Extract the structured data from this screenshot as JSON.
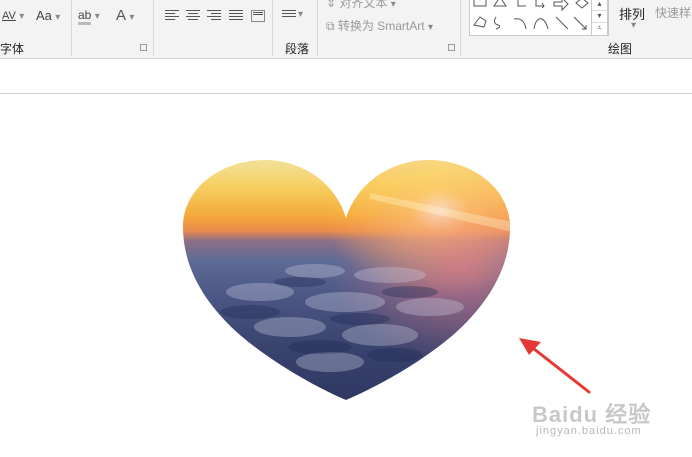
{
  "ribbon": {
    "font_group": {
      "label": "字体",
      "char_spacing": "AV",
      "change_case": "Aa",
      "highlight": "ab",
      "font_color": "A"
    },
    "paragraph_group": {
      "label": "段落",
      "align_text": "对齐文本",
      "convert_smartart": "转换为 SmartArt"
    },
    "drawing_group": {
      "label": "绘图",
      "arrange": "排列",
      "quick_styles": "快速样"
    }
  },
  "slide": {
    "heart_picture": "heart-shaped sunset over clouds image",
    "arrow_color": "#e53935"
  },
  "watermark": {
    "brand": "Baidu 经验",
    "url": "jingyan.baidu.com"
  }
}
